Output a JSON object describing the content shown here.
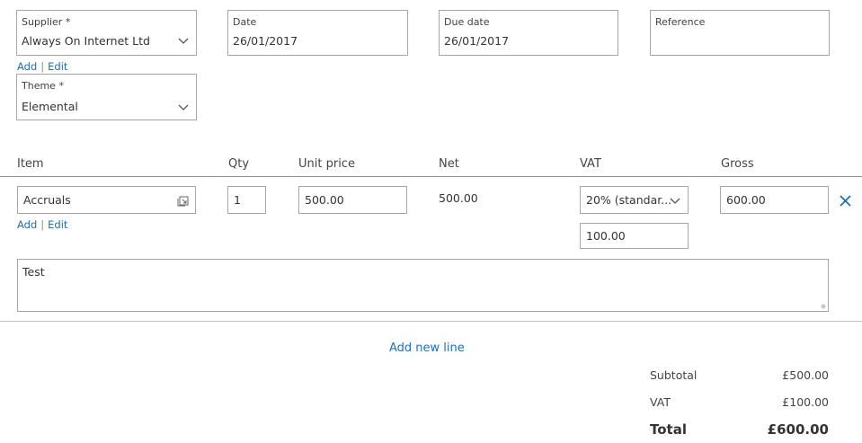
{
  "header": {
    "supplier": {
      "label": "Supplier *",
      "value": "Always On Internet Ltd"
    },
    "supplier_links": {
      "add": "Add",
      "sep": "|",
      "edit": "Edit"
    },
    "date": {
      "label": "Date",
      "value": "26/01/2017"
    },
    "due_date": {
      "label": "Due date",
      "value": "26/01/2017"
    },
    "reference": {
      "label": "Reference",
      "value": ""
    },
    "theme": {
      "label": "Theme *",
      "value": "Elemental"
    }
  },
  "columns": {
    "item": "Item",
    "qty": "Qty",
    "unit_price": "Unit price",
    "net": "Net",
    "vat": "VAT",
    "gross": "Gross"
  },
  "line": {
    "item": "Accruals",
    "item_links": {
      "add": "Add",
      "sep": "|",
      "edit": "Edit"
    },
    "qty": "1",
    "unit_price": "500.00",
    "net": "500.00",
    "vat_rate": "20% (standar...",
    "vat_amount": "100.00",
    "gross": "600.00",
    "description": "Test"
  },
  "actions": {
    "add_new_line": "Add new line"
  },
  "totals": {
    "subtotal_label": "Subtotal",
    "subtotal_value": "£500.00",
    "vat_label": "VAT",
    "vat_value": "£100.00",
    "total_label": "Total",
    "total_value": "£600.00"
  },
  "colors": {
    "link": "#1f6fb2",
    "border": "#a6a6a6",
    "delete_icon": "#1f6fb2"
  },
  "icons": [
    "chevron-down-icon",
    "item-lookup-icon",
    "delete-line-icon",
    "resize-grip-icon"
  ]
}
